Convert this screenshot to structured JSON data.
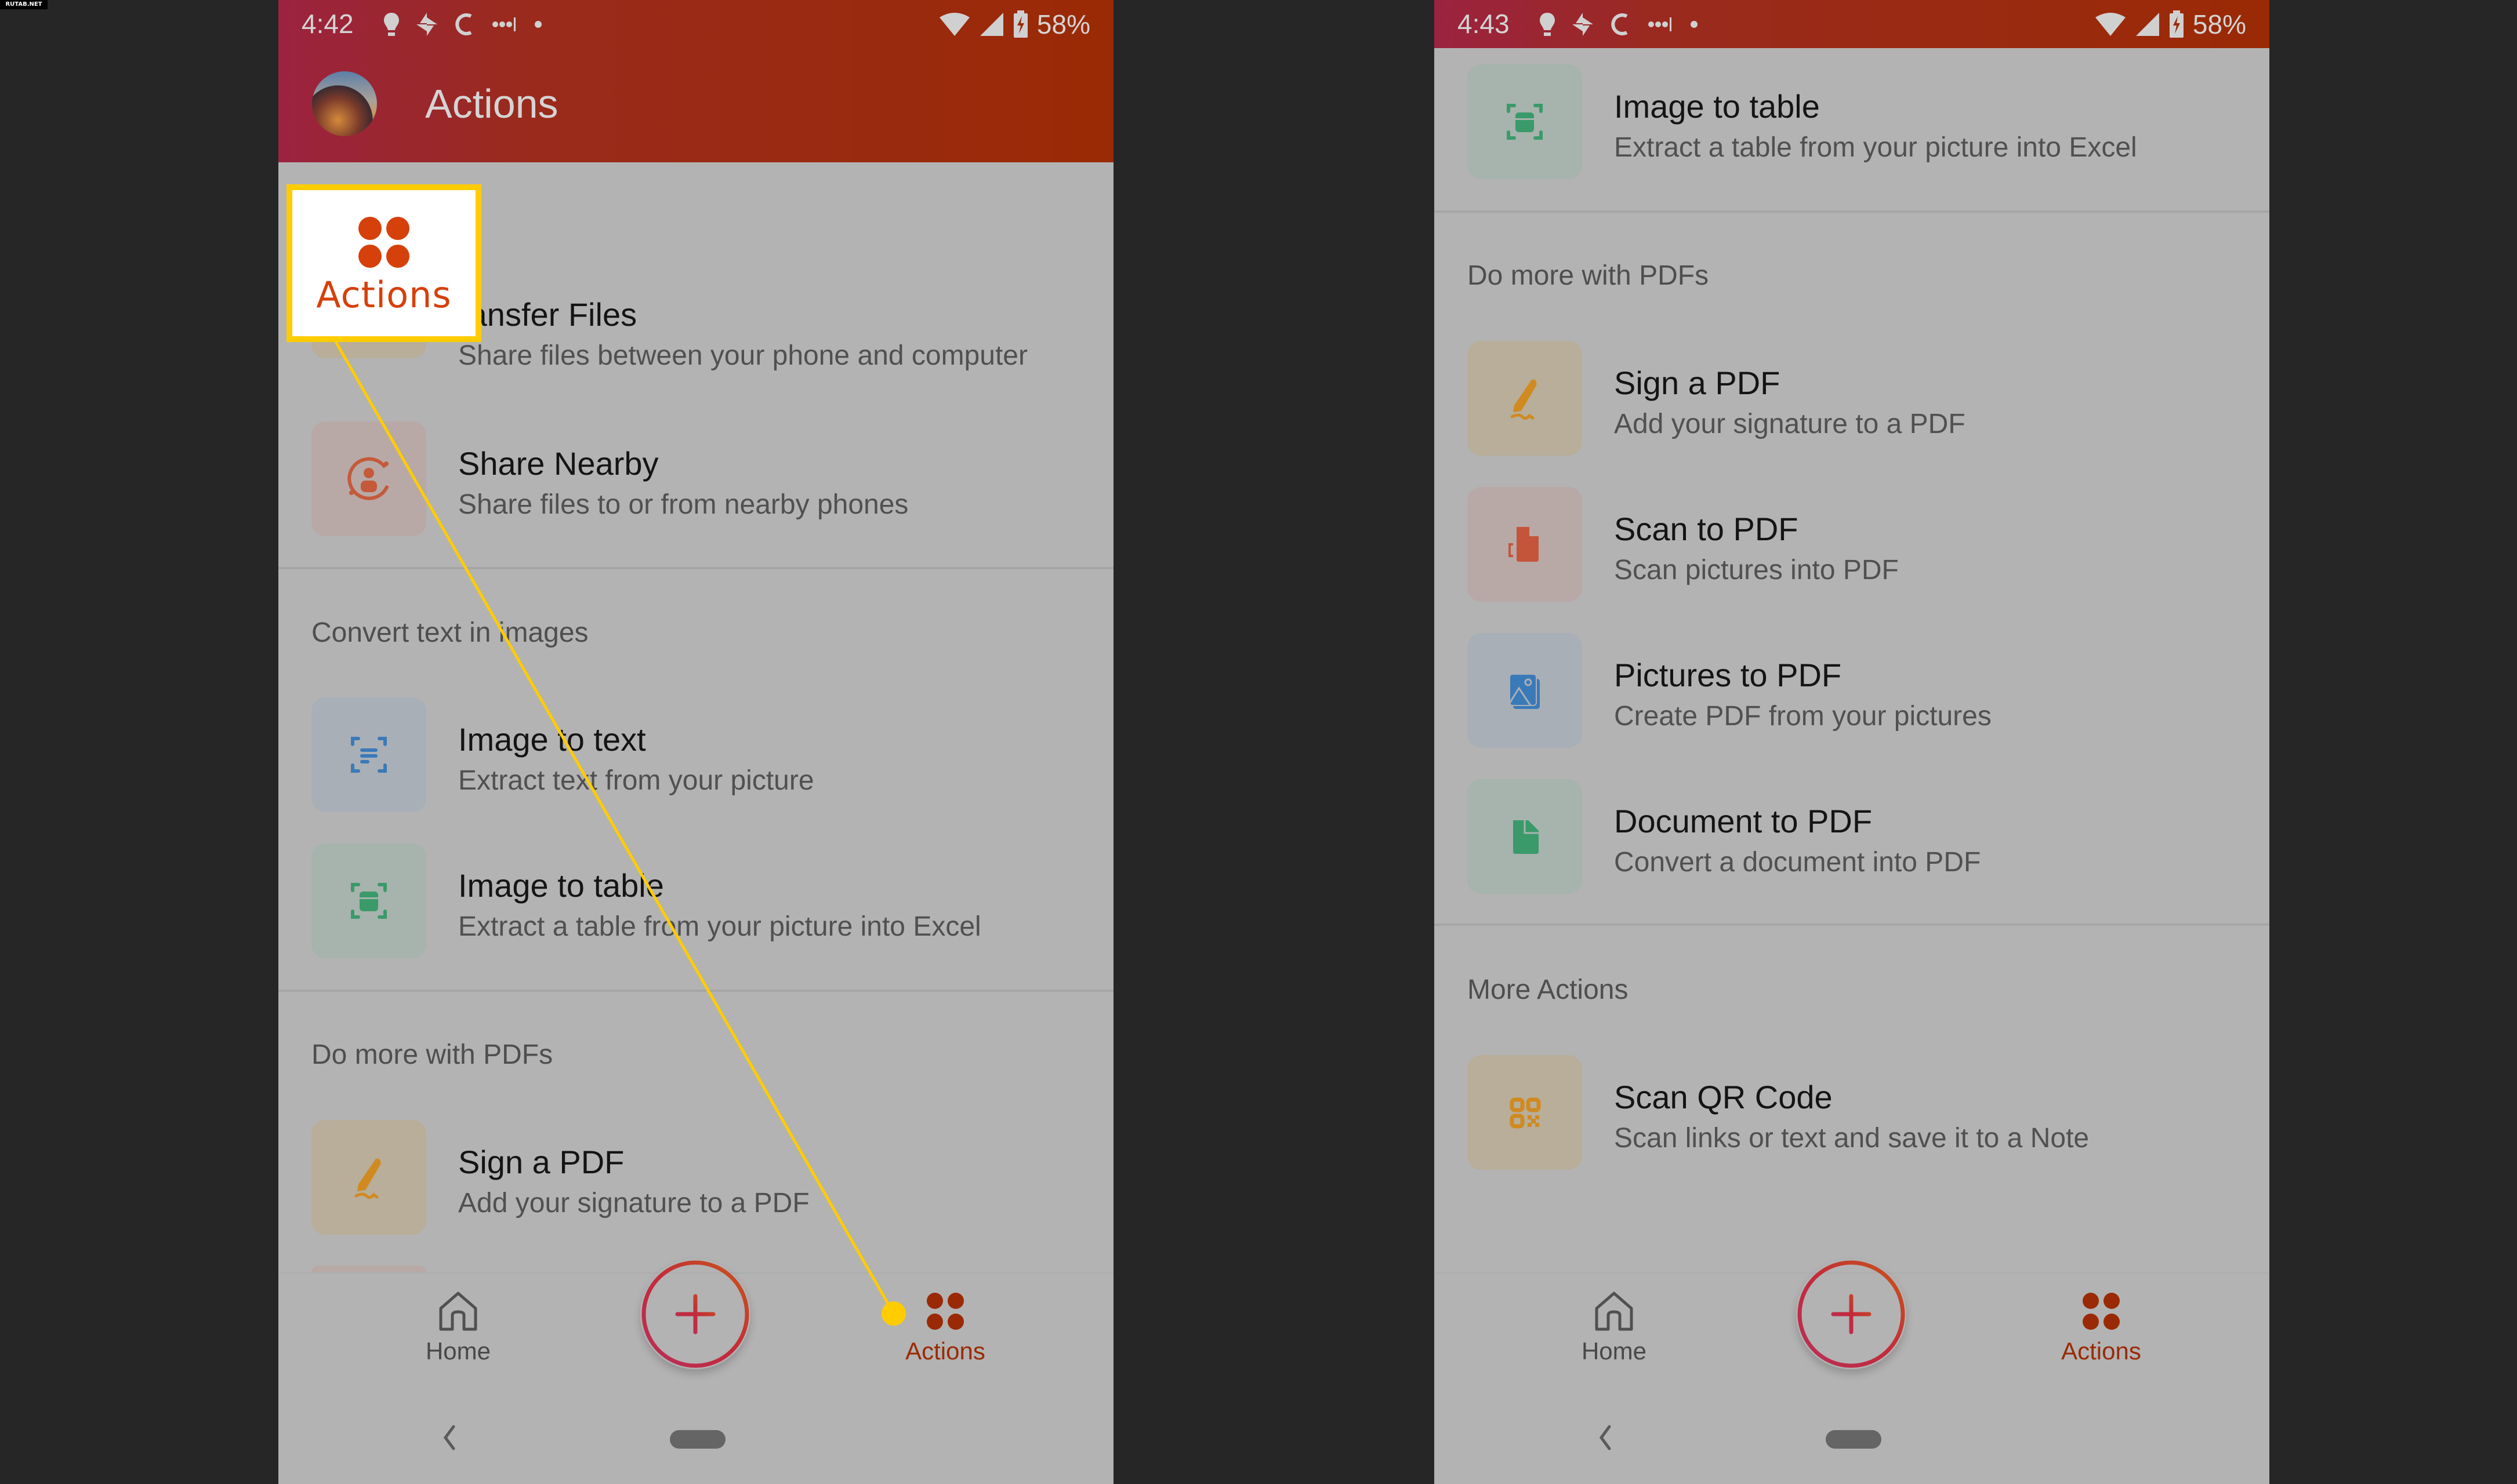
{
  "watermark": "RUTAB.NET",
  "colors": {
    "brand": "#9a2a05",
    "brand_alt": "#9b2340",
    "callout_border": "#ffcc00",
    "actions_accent": "#d6400a",
    "dimmed_bg": "#b3b3b3",
    "background": "#262626"
  },
  "callout": {
    "icon": "actions-grid-icon",
    "label": "Actions"
  },
  "left_phone": {
    "status": {
      "time": "4:42",
      "battery": "58%",
      "icons": [
        "lightbulb-icon",
        "pinwheel-icon",
        "sync-icon",
        "dots-icon",
        "dot-icon"
      ],
      "right_icons": [
        "wifi-icon",
        "signal-icon",
        "battery-charging-icon"
      ]
    },
    "header": {
      "title": "Actions",
      "avatar": "profile-avatar"
    },
    "content": {
      "items_top": [
        {
          "icon": "transfer-files-icon",
          "title": "Transfer Files",
          "title_visible": "ransfer Files",
          "subtitle": "Share files between your phone and computer"
        },
        {
          "icon": "share-nearby-icon",
          "title": "Share Nearby",
          "subtitle": "Share files to or from nearby phones"
        }
      ],
      "sections": [
        {
          "heading": "Convert text in images",
          "items": [
            {
              "icon": "image-to-text-icon",
              "title": "Image to text",
              "subtitle": "Extract text from your picture"
            },
            {
              "icon": "image-to-table-icon",
              "title": "Image to table",
              "subtitle": "Extract a table from your picture into Excel"
            }
          ]
        },
        {
          "heading": "Do more with PDFs",
          "items": [
            {
              "icon": "sign-pdf-icon",
              "title": "Sign a PDF",
              "subtitle": "Add your signature to a PDF"
            }
          ]
        }
      ]
    },
    "bottom_nav": {
      "home": "Home",
      "actions": "Actions",
      "fab": "add-icon"
    }
  },
  "right_phone": {
    "status": {
      "time": "4:43",
      "battery": "58%"
    },
    "content": {
      "items_top": [
        {
          "icon": "image-to-table-icon",
          "title": "Image to table",
          "subtitle": "Extract a table from your picture into Excel"
        }
      ],
      "sections": [
        {
          "heading": "Do more with PDFs",
          "items": [
            {
              "icon": "sign-pdf-icon",
              "title": "Sign a PDF",
              "subtitle": "Add your signature to a PDF"
            },
            {
              "icon": "scan-to-pdf-icon",
              "title": "Scan to PDF",
              "subtitle": "Scan pictures into PDF"
            },
            {
              "icon": "pictures-to-pdf-icon",
              "title": "Pictures to PDF",
              "subtitle": "Create PDF from your pictures"
            },
            {
              "icon": "document-to-pdf-icon",
              "title": "Document to PDF",
              "subtitle": "Convert a document into PDF"
            }
          ]
        },
        {
          "heading": "More Actions",
          "items": [
            {
              "icon": "scan-qr-code-icon",
              "title": "Scan QR Code",
              "subtitle": "Scan links or text and save it to a Note"
            }
          ]
        }
      ]
    },
    "bottom_nav": {
      "home": "Home",
      "actions": "Actions",
      "fab": "add-icon"
    }
  }
}
